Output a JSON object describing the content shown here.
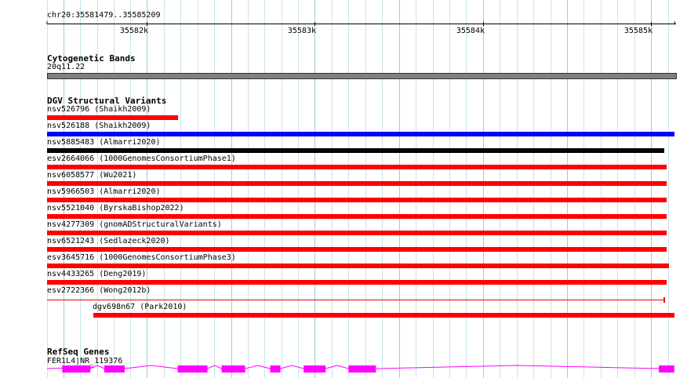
{
  "location": "chr20:35581479..35585209",
  "ruler": {
    "ticks": [
      "35582k",
      "35583k",
      "35584k",
      "35585k"
    ]
  },
  "cytobands": {
    "title": "Cytogenetic Bands",
    "band_label": "20q11.22",
    "band_color": "#808080"
  },
  "dgv": {
    "title": "DGV Structural Variants",
    "variants": [
      {
        "label": "nsv526796 (Shaikh2009)",
        "color": "#ff0000",
        "start": 35581479,
        "end": 35582258
      },
      {
        "label": "nsv526188 (Shaikh2009)",
        "color": "#0000ff",
        "start": 35581479,
        "end": 35585209
      },
      {
        "label": "nsv5885483 (Almarri2020)",
        "color": "#000000",
        "start": 35581479,
        "end": 35585149
      },
      {
        "label": "esv2664066 (1000GenomesConsortiumPhase1)",
        "color": "#ff0000",
        "start": 35581479,
        "end": 35585163
      },
      {
        "label": "nsv6058577 (Wu2021)",
        "color": "#ff0000",
        "start": 35581479,
        "end": 35585163
      },
      {
        "label": "nsv5966503 (Almarri2020)",
        "color": "#ff0000",
        "start": 35581479,
        "end": 35585163
      },
      {
        "label": "nsv5521040 (ByrskaBishop2022)",
        "color": "#ff0000",
        "start": 35581479,
        "end": 35585163
      },
      {
        "label": "nsv4277309 (gnomADStructuralVariants)",
        "color": "#ff0000",
        "start": 35581479,
        "end": 35585163
      },
      {
        "label": "nsv6521243 (Sedlazeck2020)",
        "color": "#ff0000",
        "start": 35581479,
        "end": 35585163
      },
      {
        "label": "esv3645716 (1000GenomesConsortiumPhase3)",
        "color": "#ff0000",
        "start": 35581479,
        "end": 35585177
      },
      {
        "label": "nsv4433265 (Deng2019)",
        "color": "#ff0000",
        "start": 35581479,
        "end": 35585163
      },
      {
        "label": "esv2722366 (Wong2012b)",
        "color": "#ff0000",
        "start": 35581479,
        "end": 35585153,
        "style": "thin"
      },
      {
        "label": "dgv698n67 (Park2010)",
        "color": "#ff0000",
        "start": 35581754,
        "end": 35585209
      }
    ]
  },
  "refseq": {
    "title": "RefSeq Genes",
    "gene_label": "FER1L4|NR_119376",
    "color": "#ff00ff",
    "exons": [
      {
        "start": 35581569,
        "end": 35581737
      },
      {
        "start": 35581819,
        "end": 35581941
      },
      {
        "start": 35582256,
        "end": 35582433
      },
      {
        "start": 35582517,
        "end": 35582657
      },
      {
        "start": 35582806,
        "end": 35582867
      },
      {
        "start": 35583005,
        "end": 35583136
      },
      {
        "start": 35583272,
        "end": 35583435
      },
      {
        "start": 35585117,
        "end": 35585209
      }
    ]
  }
}
